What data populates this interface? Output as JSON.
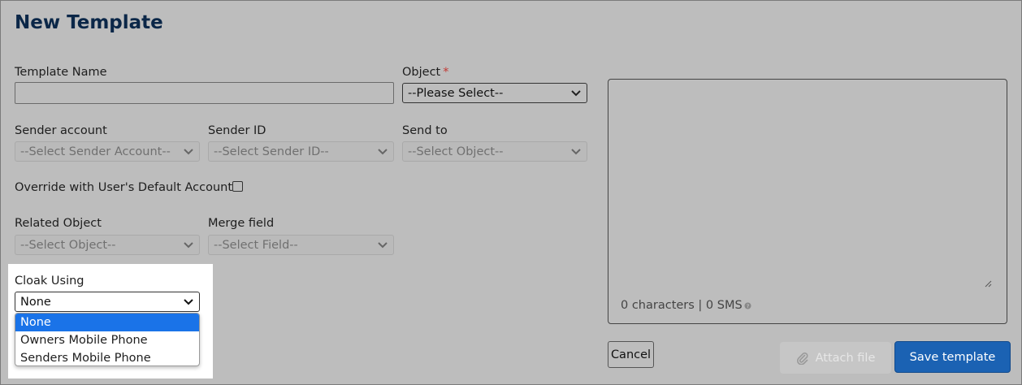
{
  "page": {
    "title": "New Template"
  },
  "form": {
    "template_name": {
      "label": "Template Name",
      "value": ""
    },
    "object": {
      "label": "Object",
      "required_marker": "*",
      "value": "--Please Select--"
    },
    "sender_account": {
      "label": "Sender account",
      "value": "--Select Sender Account--"
    },
    "sender_id": {
      "label": "Sender ID",
      "value": "--Select Sender ID--"
    },
    "send_to": {
      "label": "Send to",
      "value": "--Select Object--"
    },
    "override": {
      "label": "Override with User's Default Account:",
      "checked": false
    },
    "related_object": {
      "label": "Related Object",
      "value": "--Select Object--"
    },
    "merge_field": {
      "label": "Merge field",
      "value": "--Select Field--"
    },
    "cloak_using": {
      "label": "Cloak Using",
      "value": "None",
      "options": [
        "None",
        "Owners Mobile Phone",
        "Senders Mobile Phone"
      ]
    }
  },
  "message": {
    "value": "",
    "counter": "0 characters | 0 SMS"
  },
  "buttons": {
    "cancel": "Cancel",
    "attach": "Attach file",
    "save": "Save template"
  },
  "colors": {
    "overlay_background": "#bdbdbd",
    "title": "#0b2748",
    "primary": "#1b62b3",
    "dropdown_highlight": "#1a73e8",
    "required": "#c23934"
  }
}
